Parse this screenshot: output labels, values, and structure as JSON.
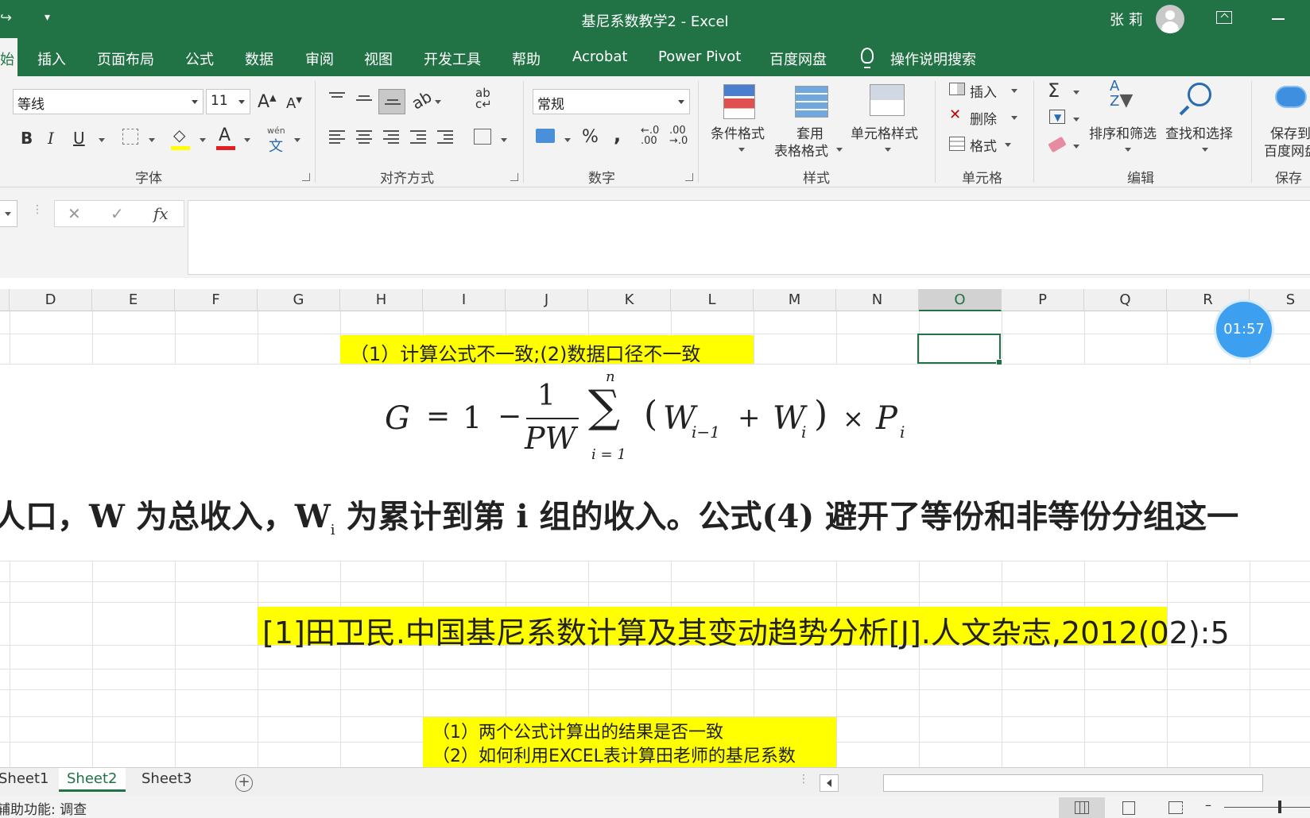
{
  "window": {
    "title": "基尼系数教学2 - Excel",
    "user": "张 莉"
  },
  "tabs": [
    "始",
    "插入",
    "页面布局",
    "公式",
    "数据",
    "审阅",
    "视图",
    "开发工具",
    "帮助",
    "Acrobat",
    "Power Pivot",
    "百度网盘",
    "操作说明搜索"
  ],
  "ribbon": {
    "font_name": "等线",
    "font_size": "11",
    "number_format": "常规",
    "bold": "B",
    "italic": "I",
    "underline": "U",
    "wen": "wén",
    "wen_zh": "文",
    "percent": "%",
    "comma": ",",
    "inc_decimal_top": "←.0",
    "inc_decimal_bot": ".00",
    "dec_decimal_top": ".00",
    "dec_decimal_bot": "→.0",
    "cond_format": "条件格式",
    "table_format_1": "套用",
    "table_format_2": "表格格式",
    "cell_style": "单元格样式",
    "insert": "插入",
    "delete": "删除",
    "format": "格式",
    "sort_filter": "排序和筛选",
    "find_select": "查找和选择",
    "save_to_1": "保存到",
    "save_to_2": "百度网盘",
    "groups": {
      "font": "字体",
      "align": "对齐方式",
      "number": "数字",
      "styles": "样式",
      "cells": "单元格",
      "edit": "编辑",
      "save": "保存"
    }
  },
  "formula_bar": {
    "fx": "fx",
    "cancel": "✕",
    "enter": "✓",
    "value": ""
  },
  "columns": [
    "D",
    "E",
    "F",
    "G",
    "H",
    "I",
    "J",
    "K",
    "L",
    "M",
    "N",
    "O",
    "P",
    "Q",
    "R",
    "S"
  ],
  "selected_column": "O",
  "cells": {
    "reason_note": "（1）计算公式不一致;(2)数据口径不一致",
    "formula": {
      "lhs": "G",
      "eq": "=",
      "one": "1",
      "minus": "−",
      "num": "1",
      "den": "PW",
      "sum_top": "n",
      "sum_bottom": "i = 1",
      "sigma": "∑",
      "lparen": "(",
      "w1": "W",
      "w1_sub": "i−1",
      "plus": "+",
      "w2": "W",
      "w2_sub": "i",
      "rparen": ")",
      "times": "×",
      "p": "P",
      "p_sub": "i"
    },
    "explanation_a": "人口，W 为总收入，W",
    "explanation_sub": "i",
    "explanation_b": " 为累计到第 i 组的收入。公式(4) 避开了等份和非等份分组这一",
    "citation_highlight": "[1]田卫民.中国基尼系数计算及其变动趋势分析[J].人文杂志,",
    "citation_rest": "2012(02):5",
    "question_1": "（1）两个公式计算出的结果是否一致",
    "question_2": "（2）如何利用EXCEL表计算田老师的基尼系数"
  },
  "timer": "01:57",
  "sheets": [
    "Sheet1",
    "Sheet2",
    "Sheet3"
  ],
  "active_sheet": "Sheet2",
  "status": {
    "accessibility": "辅助功能: 调查"
  },
  "colors": {
    "excel_green": "#217346",
    "highlight": "#ffff00",
    "timer_blue": "#3c9ff0"
  }
}
